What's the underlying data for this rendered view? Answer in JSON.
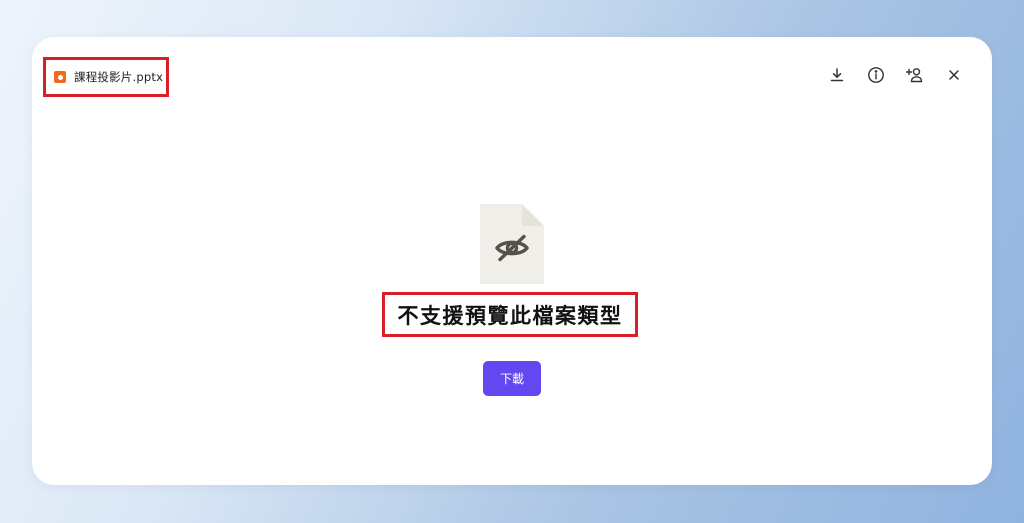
{
  "file": {
    "name": "課程投影片.pptx",
    "icon": "pptx-file-icon",
    "icon_color": "#f26b1d"
  },
  "toolbar": {
    "download_icon": "download-icon",
    "info_icon": "info-icon",
    "share_icon": "add-person-icon",
    "close_icon": "close-icon"
  },
  "preview": {
    "icon": "eye-off-document-icon",
    "message": "不支援預覽此檔案類型",
    "download_label": "下載"
  },
  "colors": {
    "accent": "#6248f0",
    "highlight": "#d81e2a",
    "doc_placeholder": "#f0eee9"
  }
}
